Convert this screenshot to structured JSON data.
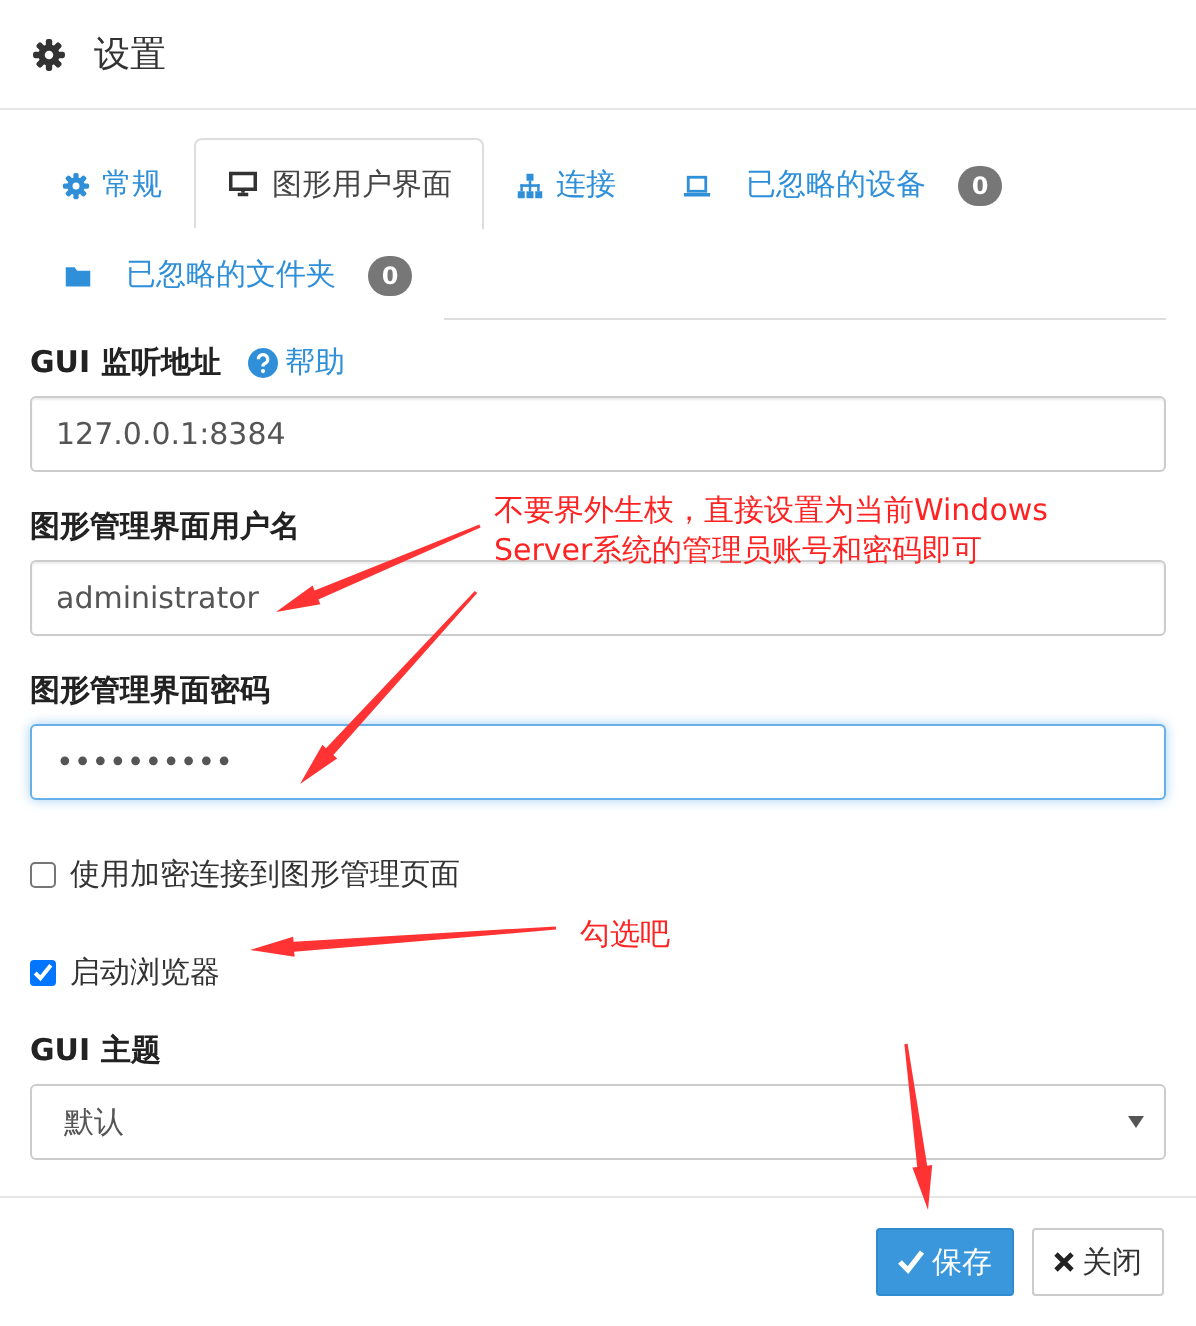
{
  "dialog": {
    "title": "设置"
  },
  "tabs": [
    {
      "label": "常规",
      "selected": false
    },
    {
      "label": "图形用户界面",
      "selected": true
    },
    {
      "label": "连接",
      "selected": false
    },
    {
      "label": "已忽略的设备",
      "selected": false,
      "badge": "0"
    },
    {
      "label": "已忽略的文件夹",
      "selected": false,
      "badge": "0"
    }
  ],
  "form": [
    {
      "kind": "text",
      "label": "GUI 监听地址",
      "help": "帮助",
      "value": "127.0.0.1:8384",
      "focused": false
    },
    {
      "kind": "text",
      "label": "图形管理界面用户名",
      "value": "administrator",
      "focused": false
    },
    {
      "kind": "text",
      "label": "图形管理界面密码",
      "value": "••••••••••",
      "focused": true
    },
    {
      "kind": "checkbox",
      "label": "使用加密连接到图形管理页面",
      "checked": false
    },
    {
      "kind": "checkbox",
      "label": "启动浏览器",
      "checked": true
    },
    {
      "kind": "select",
      "label": "GUI 主题",
      "value": "默认"
    }
  ],
  "buttons": [
    {
      "label": "保存",
      "kind": "primary"
    },
    {
      "label": "关闭",
      "kind": "default"
    }
  ],
  "annotations": [
    "不要界外生枝，直接设置为当前Windows Server系统的管理员账号和密码即可",
    "勾选吧"
  ]
}
